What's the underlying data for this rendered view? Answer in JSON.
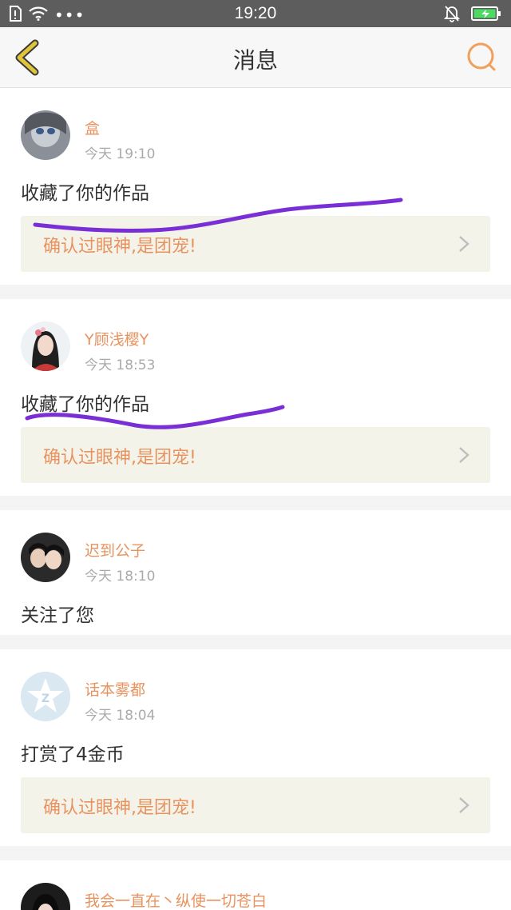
{
  "status_bar": {
    "time": "19:20",
    "left_icons": [
      "sim-alert-icon",
      "wifi-icon",
      "more-dots-icon"
    ],
    "right_icons": [
      "bell-muted-icon",
      "battery-charging-icon"
    ]
  },
  "header": {
    "title": "消息",
    "back_icon": "chevron-left-icon",
    "search_icon": "search-icon"
  },
  "colors": {
    "accent": "#e8935f",
    "back_icon": "#e0c43a",
    "status_bar": "#5d5d5d",
    "banner_bg": "#f3f3ea",
    "scribble": "#7a2fd6"
  },
  "messages": [
    {
      "name": "盒",
      "time": "今天 19:10",
      "action": "收藏了你的作品",
      "banner": "确认过眼神,是团宠!"
    },
    {
      "name": "Y顾浅樱Y",
      "time": "今天 18:53",
      "action": "收藏了你的作品",
      "banner": "确认过眼神,是团宠!"
    },
    {
      "name": "迟到公子",
      "time": "今天 18:10",
      "action": "关注了您"
    },
    {
      "name": "话本雾都",
      "time": "今天 18:04",
      "action": "打赏了4金币",
      "banner": "确认过眼神,是团宠!"
    },
    {
      "name": "我会一直在丶纵使一切苍白"
    }
  ]
}
